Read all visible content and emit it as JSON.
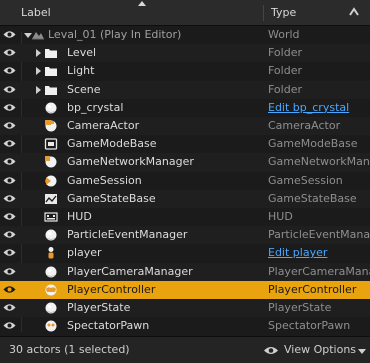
{
  "header": {
    "label": "Label",
    "type": "Type"
  },
  "rows": [
    {
      "label": "Leval_01 (Play In Editor)",
      "type": "World",
      "icon": "world-icon",
      "expander": "expanded",
      "depth": 0,
      "link": false,
      "selected": false
    },
    {
      "label": "Level",
      "type": "Folder",
      "icon": "folder-icon",
      "expander": "collapsed",
      "depth": 1,
      "link": false,
      "selected": false
    },
    {
      "label": "Light",
      "type": "Folder",
      "icon": "folder-icon",
      "expander": "collapsed",
      "depth": 1,
      "link": false,
      "selected": false
    },
    {
      "label": "Scene",
      "type": "Folder",
      "icon": "folder-icon",
      "expander": "collapsed",
      "depth": 1,
      "link": false,
      "selected": false
    },
    {
      "label": "bp_crystal",
      "type": "Edit bp_crystal",
      "icon": "sphere-icon",
      "expander": "none",
      "depth": 2,
      "link": true,
      "selected": false
    },
    {
      "label": "CameraActor",
      "type": "CameraActor",
      "icon": "camera-actor-icon",
      "expander": "none",
      "depth": 2,
      "link": false,
      "selected": false
    },
    {
      "label": "GameModeBase",
      "type": "GameModeBase",
      "icon": "game-mode-icon",
      "expander": "none",
      "depth": 2,
      "link": false,
      "selected": false
    },
    {
      "label": "GameNetworkManager",
      "type": "GameNetworkManager",
      "icon": "network-manager-icon",
      "expander": "none",
      "depth": 2,
      "link": false,
      "selected": false
    },
    {
      "label": "GameSession",
      "type": "GameSession",
      "icon": "game-session-icon",
      "expander": "none",
      "depth": 2,
      "link": false,
      "selected": false
    },
    {
      "label": "GameStateBase",
      "type": "GameStateBase",
      "icon": "game-state-icon",
      "expander": "none",
      "depth": 2,
      "link": false,
      "selected": false
    },
    {
      "label": "HUD",
      "type": "HUD",
      "icon": "hud-icon",
      "expander": "none",
      "depth": 2,
      "link": false,
      "selected": false
    },
    {
      "label": "ParticleEventManager",
      "type": "ParticleEventManager",
      "icon": "sphere-icon",
      "expander": "none",
      "depth": 2,
      "link": false,
      "selected": false
    },
    {
      "label": "player",
      "type": "Edit player",
      "icon": "player-icon",
      "expander": "none",
      "depth": 2,
      "link": true,
      "selected": false
    },
    {
      "label": "PlayerCameraManager",
      "type": "PlayerCameraManager",
      "icon": "sphere-icon",
      "expander": "none",
      "depth": 2,
      "link": false,
      "selected": false
    },
    {
      "label": "PlayerController",
      "type": "PlayerController",
      "icon": "player-controller-icon",
      "expander": "none",
      "depth": 2,
      "link": false,
      "selected": true
    },
    {
      "label": "PlayerState",
      "type": "PlayerState",
      "icon": "sphere-icon",
      "expander": "none",
      "depth": 2,
      "link": false,
      "selected": false
    },
    {
      "label": "SpectatorPawn",
      "type": "SpectatorPawn",
      "icon": "spectator-pawn-icon",
      "expander": "none",
      "depth": 2,
      "link": false,
      "selected": false
    }
  ],
  "footer": {
    "status": "30 actors (1 selected)",
    "view_options": "View Options"
  },
  "colors": {
    "selected": "#e8a30e",
    "link": "#4aa7ff",
    "background": "#1b1b1b"
  }
}
